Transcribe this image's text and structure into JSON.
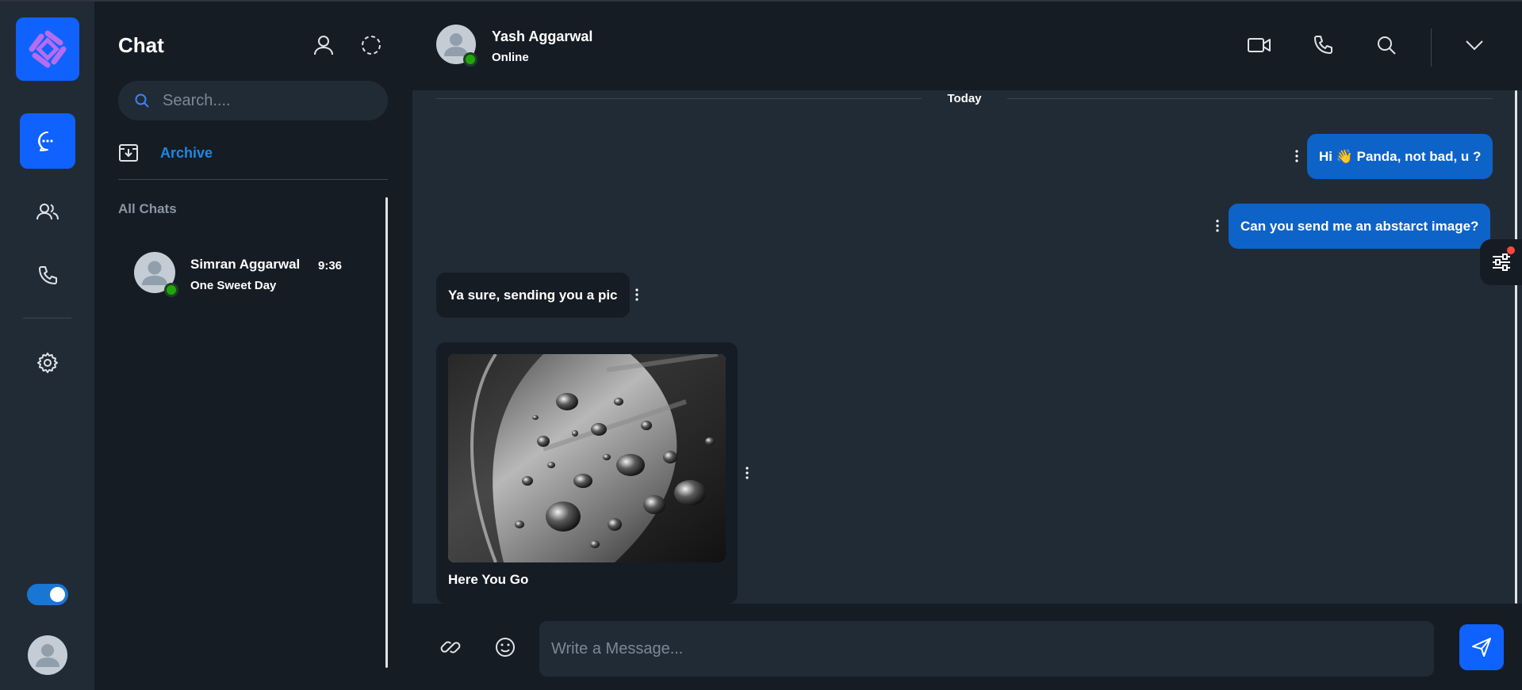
{
  "nav": {
    "items": [
      {
        "name": "chats",
        "icon": "chat-icon",
        "active": true
      },
      {
        "name": "groups",
        "icon": "users-icon",
        "active": false
      },
      {
        "name": "calls",
        "icon": "phone-icon",
        "active": false
      },
      {
        "name": "settings",
        "icon": "gear-icon",
        "active": false
      }
    ],
    "theme_toggle_on": true
  },
  "chat_list": {
    "title": "Chat",
    "search_placeholder": "Search....",
    "archive_label": "Archive",
    "section_label": "All Chats",
    "items": [
      {
        "name": "Simran Aggarwal",
        "time": "9:36",
        "preview": "One Sweet Day",
        "online": true
      }
    ]
  },
  "conversation": {
    "contact_name": "Yash Aggarwal",
    "contact_status": "Online",
    "date_divider": "Today",
    "messages": [
      {
        "direction": "outgoing",
        "text": "Hi 👋 Panda, not bad, u ?"
      },
      {
        "direction": "outgoing",
        "text": "Can you send me an abstarct image?"
      },
      {
        "direction": "incoming",
        "text": "Ya sure, sending you a pic"
      },
      {
        "direction": "incoming",
        "type": "image",
        "caption": "Here You Go"
      }
    ],
    "composer_placeholder": "Write a Message..."
  },
  "colors": {
    "accent": "#0f62fe",
    "outgoing_bubble": "#0e63c8",
    "online": "#22a50a",
    "link": "#1e88e5",
    "notification": "#ff4842"
  }
}
